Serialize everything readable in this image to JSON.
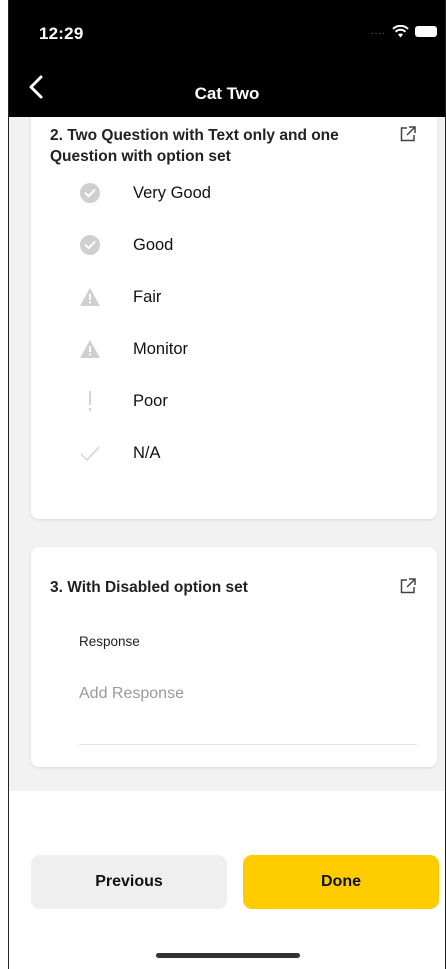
{
  "status_bar": {
    "time": "12:29",
    "signal": "....",
    "icons": [
      "wifi-icon",
      "battery-icon"
    ]
  },
  "nav": {
    "title": "Cat Two",
    "back_icon": "chevron-left-icon"
  },
  "questions": [
    {
      "title": "2. Two Question with Text only and one Question with option set",
      "icon": "external-link-icon",
      "options": [
        {
          "label": "Very Good",
          "icon": "check-circle-icon"
        },
        {
          "label": "Good",
          "icon": "check-circle-icon"
        },
        {
          "label": "Fair",
          "icon": "warning-triangle-icon"
        },
        {
          "label": "Monitor",
          "icon": "warning-triangle-icon"
        },
        {
          "label": "Poor",
          "icon": "exclamation-icon"
        },
        {
          "label": "N/A",
          "icon": "checkmark-icon"
        }
      ]
    },
    {
      "title": "3. With Disabled option set",
      "icon": "external-link-icon",
      "response_label": "Response",
      "response_placeholder": "Add Response"
    }
  ],
  "footer": {
    "previous_label": "Previous",
    "done_label": "Done"
  },
  "colors": {
    "accent": "#ffcc00",
    "header_bg": "#000000",
    "icon_gray": "#c8c8c8"
  }
}
